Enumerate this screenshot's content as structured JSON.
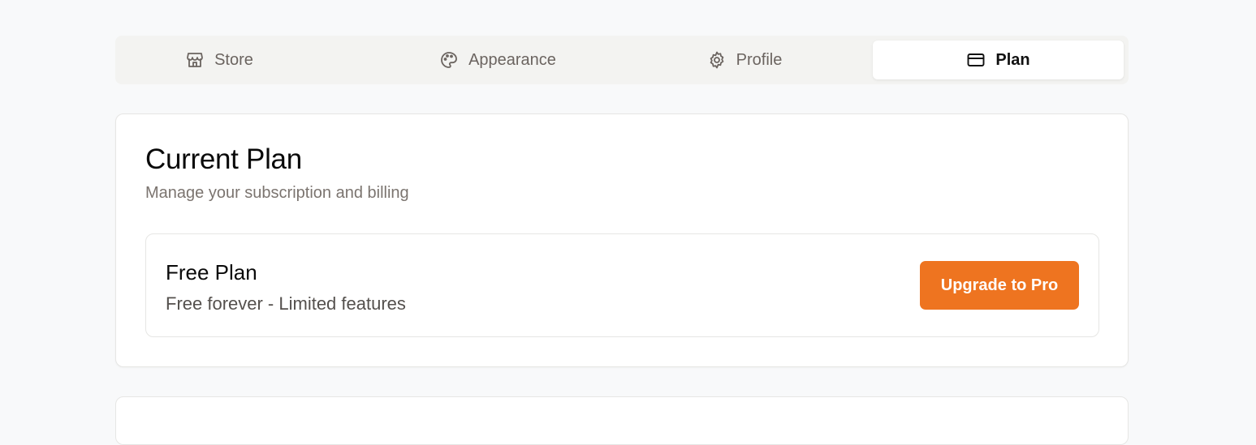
{
  "tabs": [
    {
      "label": "Store",
      "icon": "store-icon",
      "active": false
    },
    {
      "label": "Appearance",
      "icon": "palette-icon",
      "active": false
    },
    {
      "label": "Profile",
      "icon": "gear-icon",
      "active": false
    },
    {
      "label": "Plan",
      "icon": "credit-card-icon",
      "active": true
    }
  ],
  "current_plan": {
    "title": "Current Plan",
    "subtitle": "Manage your subscription and billing",
    "plan_name": "Free Plan",
    "plan_description": "Free forever - Limited features",
    "upgrade_label": "Upgrade to Pro"
  },
  "colors": {
    "accent": "#ee7420",
    "background": "#f8f9fa",
    "tab_bar": "#f3f3f1",
    "muted_text": "#7b746f"
  }
}
